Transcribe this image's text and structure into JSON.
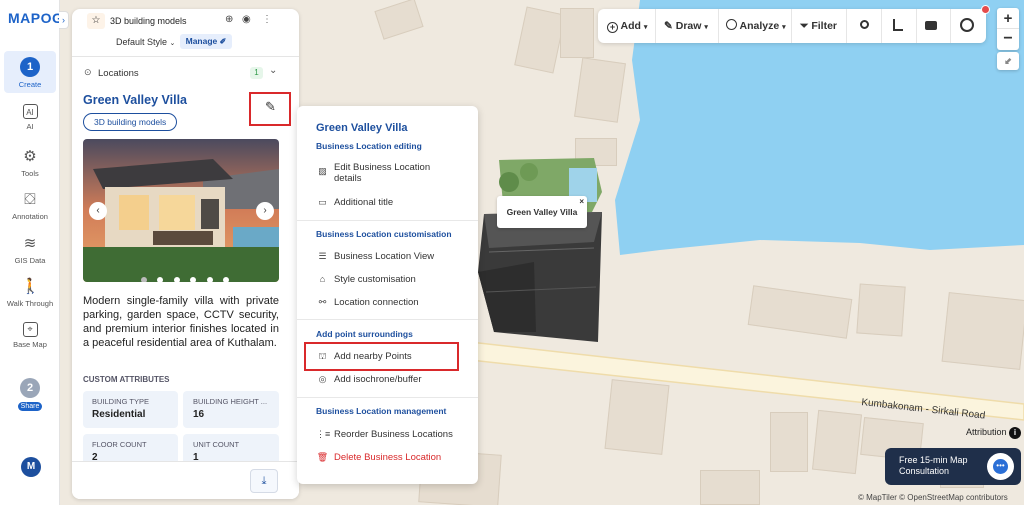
{
  "rail": {
    "logo": "MAPOG",
    "create_step": "1",
    "create": "Create",
    "ai": "AI",
    "tools": "Tools",
    "annotation": "Annotation",
    "gis": "GIS Data",
    "walk": "Walk Through",
    "basemap": "Base Map",
    "share_step": "2",
    "share": "Share",
    "avatar": "M"
  },
  "panel": {
    "map_title": "3D building models",
    "default_style": "Default Style",
    "manage": "Manage",
    "locations_label": "Locations",
    "locations_count": "1",
    "place_title": "Green Valley Villa",
    "category_tag": "3D building models",
    "description": "Modern single-family villa with private parking, garden space, CCTV security, and premium interior finishes located in a peaceful residential area of Kuthalam.",
    "attr_heading": "CUSTOM ATTRIBUTES",
    "attributes": [
      {
        "label": "BUILDING TYPE",
        "value": "Residential"
      },
      {
        "label": "BUILDING HEIGHT ...",
        "value": "16"
      },
      {
        "label": "FLOOR COUNT",
        "value": "2"
      },
      {
        "label": "UNIT COUNT",
        "value": "1"
      }
    ]
  },
  "menu": {
    "title": "Green Valley Villa",
    "sec1": "Business Location editing",
    "edit_details": "Edit Business Location details",
    "additional_title": "Additional title",
    "sec2": "Business Location customisation",
    "view": "Business Location View",
    "style": "Style customisation",
    "connection": "Location connection",
    "sec3": "Add point surroundings",
    "nearby": "Add nearby Points",
    "isochrone": "Add isochrone/buffer",
    "sec4": "Business Location management",
    "reorder": "Reorder Business Locations",
    "delete": "Delete Business Location"
  },
  "toolbar": {
    "add": "Add",
    "draw": "Draw",
    "analyze": "Analyze",
    "filter": "Filter"
  },
  "map": {
    "marker_label": "Green Valley Villa",
    "road_label": "Kumbakonam - Sirkali Road",
    "attribution": "Attribution",
    "credits": "© MapTiler © OpenStreetMap contributors",
    "consult_line1": "Free 15-min Map",
    "consult_line2": "Consultation"
  },
  "colors": {
    "brand": "#1d63c8",
    "highlight": "#d9292b",
    "delete": "#d9292b",
    "water": "#8fd0f2"
  }
}
